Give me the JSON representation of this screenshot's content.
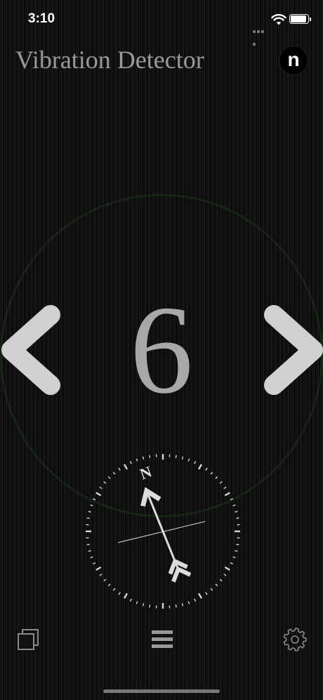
{
  "status_bar": {
    "time": "3:10",
    "battery_level": 0.95,
    "icons": [
      "signal-dots-icon",
      "wifi-icon",
      "battery-icon"
    ]
  },
  "header": {
    "title": "Vibration Detector",
    "badge_letter": "n"
  },
  "main": {
    "counter_value": "6",
    "prev_icon": "chevron-left-icon",
    "next_icon": "chevron-right-icon"
  },
  "compass": {
    "north_label": "N",
    "needle_heading_deg": -22
  },
  "toolbar": {
    "icons": [
      "copy-icon",
      "menu-icon",
      "gear-icon"
    ]
  },
  "colors": {
    "background": "#0d0d0d",
    "title": "#9a9a9a",
    "counter": "#a8a8a8",
    "arrow": "#d0d0d0",
    "glow": "#285a28"
  }
}
